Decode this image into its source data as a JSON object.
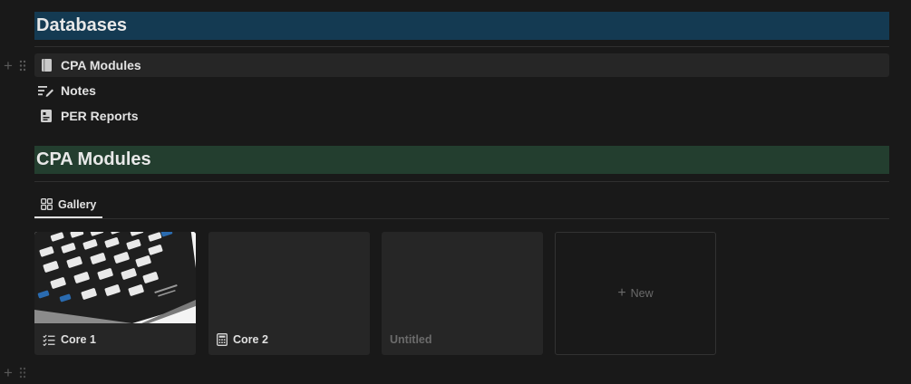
{
  "databases_heading": "Databases",
  "database_links": [
    {
      "label": "CPA Modules",
      "icon": "book-icon"
    },
    {
      "label": "Notes",
      "icon": "notes-pen-icon"
    },
    {
      "label": "PER Reports",
      "icon": "report-icon"
    }
  ],
  "section_heading": "CPA Modules",
  "view_tab": {
    "label": "Gallery",
    "icon": "gallery-grid-icon"
  },
  "gallery": {
    "cards": [
      {
        "title": "Core 1",
        "icon": "checklist-icon",
        "cover": "calculator-photo"
      },
      {
        "title": "Core 2",
        "icon": "calculator-icon"
      },
      {
        "title": "Untitled"
      }
    ],
    "new_label": "New"
  },
  "colors": {
    "background": "#191919",
    "heading_blue": "#143a52",
    "heading_green": "#233e2f",
    "card": "#262626"
  }
}
